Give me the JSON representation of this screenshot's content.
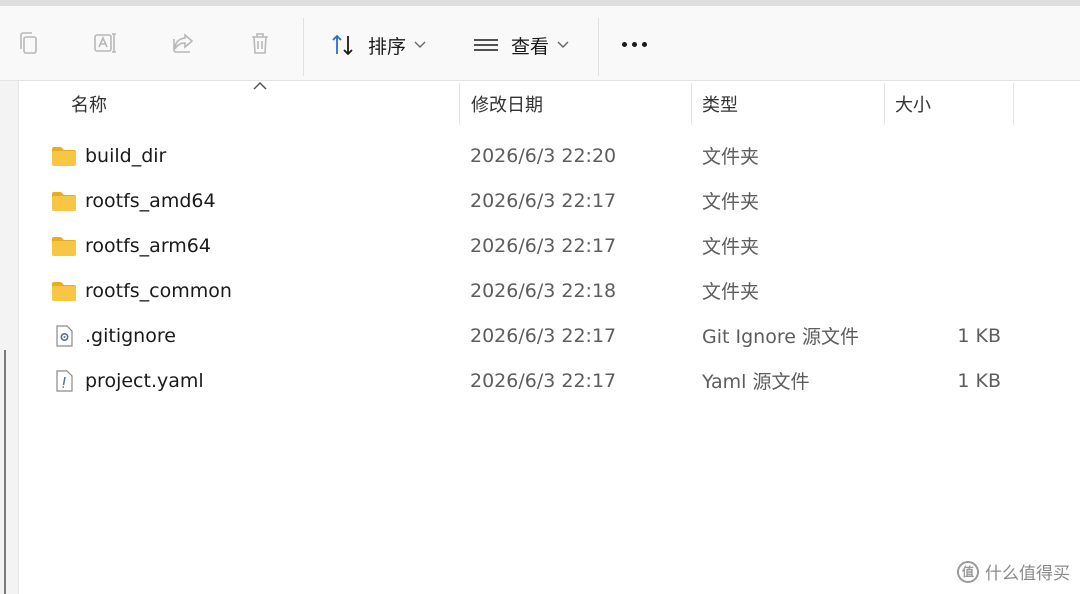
{
  "toolbar": {
    "sort_label": "排序",
    "view_label": "查看"
  },
  "columns": {
    "name": "名称",
    "date": "修改日期",
    "type": "类型",
    "size": "大小"
  },
  "files": [
    {
      "name": "build_dir",
      "date": "2026/6/3 22:20",
      "type": "文件夹",
      "size": "",
      "icon": "folder-icon"
    },
    {
      "name": "rootfs_amd64",
      "date": "2026/6/3 22:17",
      "type": "文件夹",
      "size": "",
      "icon": "folder-icon"
    },
    {
      "name": "rootfs_arm64",
      "date": "2026/6/3 22:17",
      "type": "文件夹",
      "size": "",
      "icon": "folder-icon"
    },
    {
      "name": "rootfs_common",
      "date": "2026/6/3 22:18",
      "type": "文件夹",
      "size": "",
      "icon": "folder-icon"
    },
    {
      "name": ".gitignore",
      "date": "2026/6/3 22:17",
      "type": "Git Ignore 源文件",
      "size": "1 KB",
      "icon": "settings-file-icon"
    },
    {
      "name": "project.yaml",
      "date": "2026/6/3 22:17",
      "type": "Yaml 源文件",
      "size": "1 KB",
      "icon": "text-file-icon"
    }
  ],
  "watermark": {
    "logo": "值",
    "text": "什么值得买"
  },
  "colors": {
    "folder": "#f8c645",
    "folder_dark": "#e8ad1f",
    "icon_gray": "#b8b8b8",
    "sort_blue": "#2a6fc9"
  }
}
